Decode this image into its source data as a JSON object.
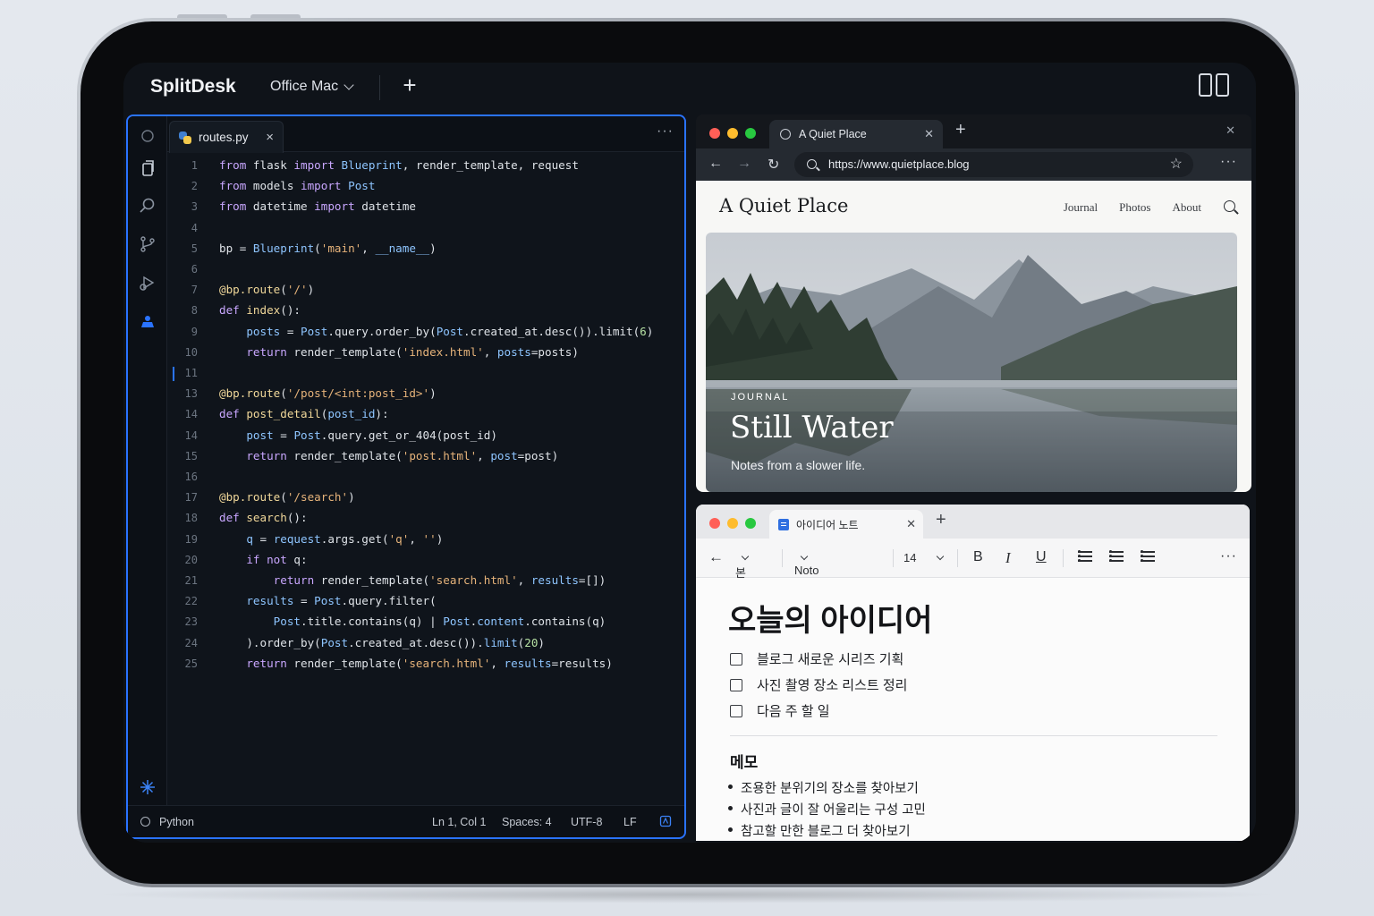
{
  "topbar": {
    "app_title": "SplitDesk",
    "profile": "Office Mac",
    "add_label": "+"
  },
  "editor": {
    "tab_name": "routes.py",
    "tab_close": "×",
    "menu": "···",
    "lines": [
      {
        "n": "1",
        "html": "<span class='kw'>from</span> flask <span class='kw'>import</span> <span class='cls'>Blueprint</span>, render_template, request"
      },
      {
        "n": "2",
        "html": "<span class='kw'>from</span> models <span class='kw'>import</span> <span class='cls'>Post</span>"
      },
      {
        "n": "3",
        "html": "<span class='kw'>from</span> datetime <span class='kw'>import</span> datetime"
      },
      {
        "n": "4",
        "html": ""
      },
      {
        "n": "5",
        "html": "bp = <span class='cls'>Blueprint</span>(<span class='str'>'main'</span>, <span class='cls'>__name__</span>)"
      },
      {
        "n": "6",
        "html": ""
      },
      {
        "n": "7",
        "html": "<span class='dec'>@bp.route</span>(<span class='str'>'/'</span>)"
      },
      {
        "n": "8",
        "html": "<span class='kw'>def</span> <span class='fn'>index</span>():"
      },
      {
        "n": "9",
        "html": "    <span class='cls'>posts</span> = <span class='cls'>Post</span>.query.order_by(<span class='cls'>Post</span>.created_at.desc()).limit(<span class='num'>6</span>)"
      },
      {
        "n": "10",
        "html": "    <span class='kw'>return</span> render_template(<span class='str'>'index.html'</span>, <span class='cls'>posts</span>=posts)"
      },
      {
        "n": "11",
        "html": ""
      },
      {
        "n": "13",
        "html": "<span class='dec'>@bp.route</span>(<span class='str'>'/post/&lt;int:post_id&gt;'</span>)"
      },
      {
        "n": "14",
        "html": "<span class='kw'>def</span> <span class='fn'>post_detail</span>(<span class='cls'>post_id</span>):"
      },
      {
        "n": "14",
        "html": "    <span class='cls'>post</span> = <span class='cls'>Post</span>.query.get_or_404(post_id)"
      },
      {
        "n": "15",
        "html": "    <span class='kw'>return</span> render_template(<span class='str'>'post.html'</span>, <span class='cls'>post</span>=post)"
      },
      {
        "n": "16",
        "html": ""
      },
      {
        "n": "17",
        "html": "<span class='dec'>@bp.route</span>(<span class='str'>'/search'</span>)"
      },
      {
        "n": "18",
        "html": "<span class='kw'>def</span> <span class='fn'>search</span>():"
      },
      {
        "n": "19",
        "html": "    <span class='cls'>q</span> = <span class='cls'>request</span>.args.get(<span class='str'>'q'</span>, <span class='str'>''</span>)"
      },
      {
        "n": "20",
        "html": "    <span class='kw'>if not</span> q:"
      },
      {
        "n": "21",
        "html": "        <span class='kw'>return</span> render_template(<span class='str'>'search.html'</span>, <span class='cls'>results</span>=[])"
      },
      {
        "n": "22",
        "html": "    <span class='cls'>results</span> = <span class='cls'>Post</span>.query.filter("
      },
      {
        "n": "23",
        "html": "        <span class='cls'>Post</span>.title.contains(q) | <span class='cls'>Post</span>.<span class='cls'>content</span>.contains(q)"
      },
      {
        "n": "24",
        "html": "    ).order_by(<span class='cls'>Post</span>.created_at.desc()).<span class='cls'>limit</span>(<span class='num'>20</span>)"
      },
      {
        "n": "25",
        "html": "    <span class='kw'>return</span> render_template(<span class='str'>'search.html'</span>, <span class='cls'>results</span>=results)"
      }
    ],
    "status": {
      "language": "Python",
      "position": "Ln 1, Col 1",
      "spaces": "Spaces: 4",
      "encoding": "UTF-8",
      "eol": "LF"
    }
  },
  "browser": {
    "tab_title": "A Quiet Place",
    "url": "https://www.quietplace.blog",
    "site_title": "A Quiet Place",
    "nav": [
      "Journal",
      "Photos",
      "About"
    ],
    "hero": {
      "kicker": "JOURNAL",
      "title": "Still Water",
      "subtitle": "Notes from a slower life."
    }
  },
  "notes": {
    "tab_title": "아이디어 노트",
    "toolbar": {
      "style": "본문",
      "font": "Noto Sans KR",
      "size": "14",
      "bold": "B",
      "italic": "I",
      "underline": "U"
    },
    "title": "오늘의 아이디어",
    "todos": [
      "블로그 새로운 시리즈 기획",
      "사진 촬영 장소 리스트 정리",
      "다음 주 할 일"
    ],
    "memo_title": "메모",
    "bullets": [
      "조용한 분위기의 장소를 찾아보기",
      "사진과 글이 잘 어울리는 구성 고민",
      "참고할 만한 블로그 더 찾아보기"
    ]
  },
  "colors": {
    "accent": "#2a73ff",
    "traffic_red": "#ff5f57",
    "traffic_yellow": "#febc2e",
    "traffic_green": "#28c840"
  }
}
